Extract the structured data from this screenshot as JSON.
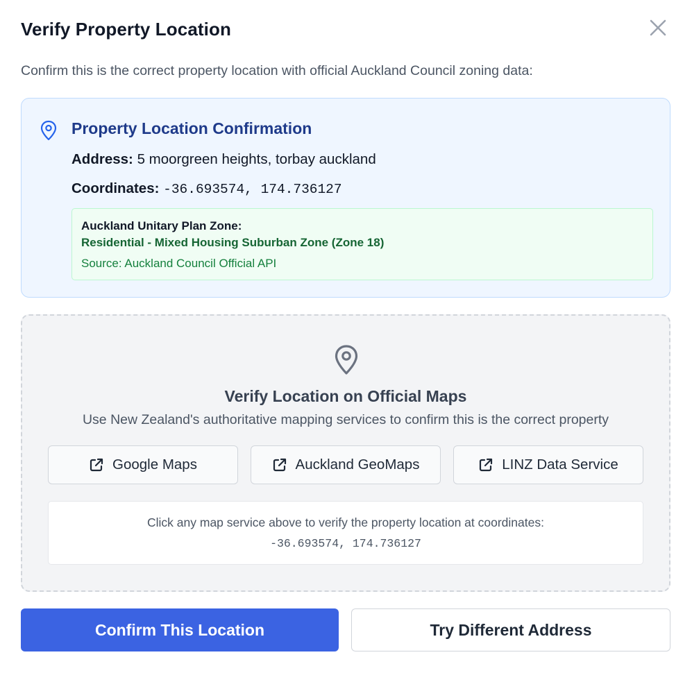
{
  "dialog": {
    "title": "Verify Property Location",
    "subtitle": "Confirm this is the correct property location with official Auckland Council zoning data:",
    "close_icon": "close-icon"
  },
  "confirmation": {
    "title": "Property Location Confirmation",
    "icon": "map-pin-icon",
    "address_label": "Address:",
    "address_value": "5 moorgreen heights, torbay auckland",
    "coordinates_label": "Coordinates:",
    "coordinates_value": "-36.693574, 174.736127",
    "zone": {
      "label": "Auckland Unitary Plan Zone:",
      "value": "Residential - Mixed Housing Suburban Zone (Zone 18)",
      "source": "Source: Auckland Council Official API"
    }
  },
  "maps": {
    "icon": "map-pin-icon",
    "title": "Verify Location on Official Maps",
    "description": "Use New Zealand's authoritative mapping services to confirm this is the correct property",
    "buttons": [
      {
        "label": "Google Maps",
        "icon": "external-link-icon"
      },
      {
        "label": "Auckland GeoMaps",
        "icon": "external-link-icon"
      },
      {
        "label": "LINZ Data Service",
        "icon": "external-link-icon"
      }
    ],
    "info_text": "Click any map service above to verify the property location at coordinates:",
    "info_coordinates": "-36.693574, 174.736127"
  },
  "actions": {
    "confirm_label": "Confirm This Location",
    "retry_label": "Try Different Address"
  },
  "colors": {
    "primary": "#3b63e2",
    "card_bg": "#eff6ff",
    "card_title": "#1e3a8a",
    "zone_bg": "#f0fdf4",
    "zone_text": "#166534",
    "panel_bg": "#f3f4f6"
  }
}
